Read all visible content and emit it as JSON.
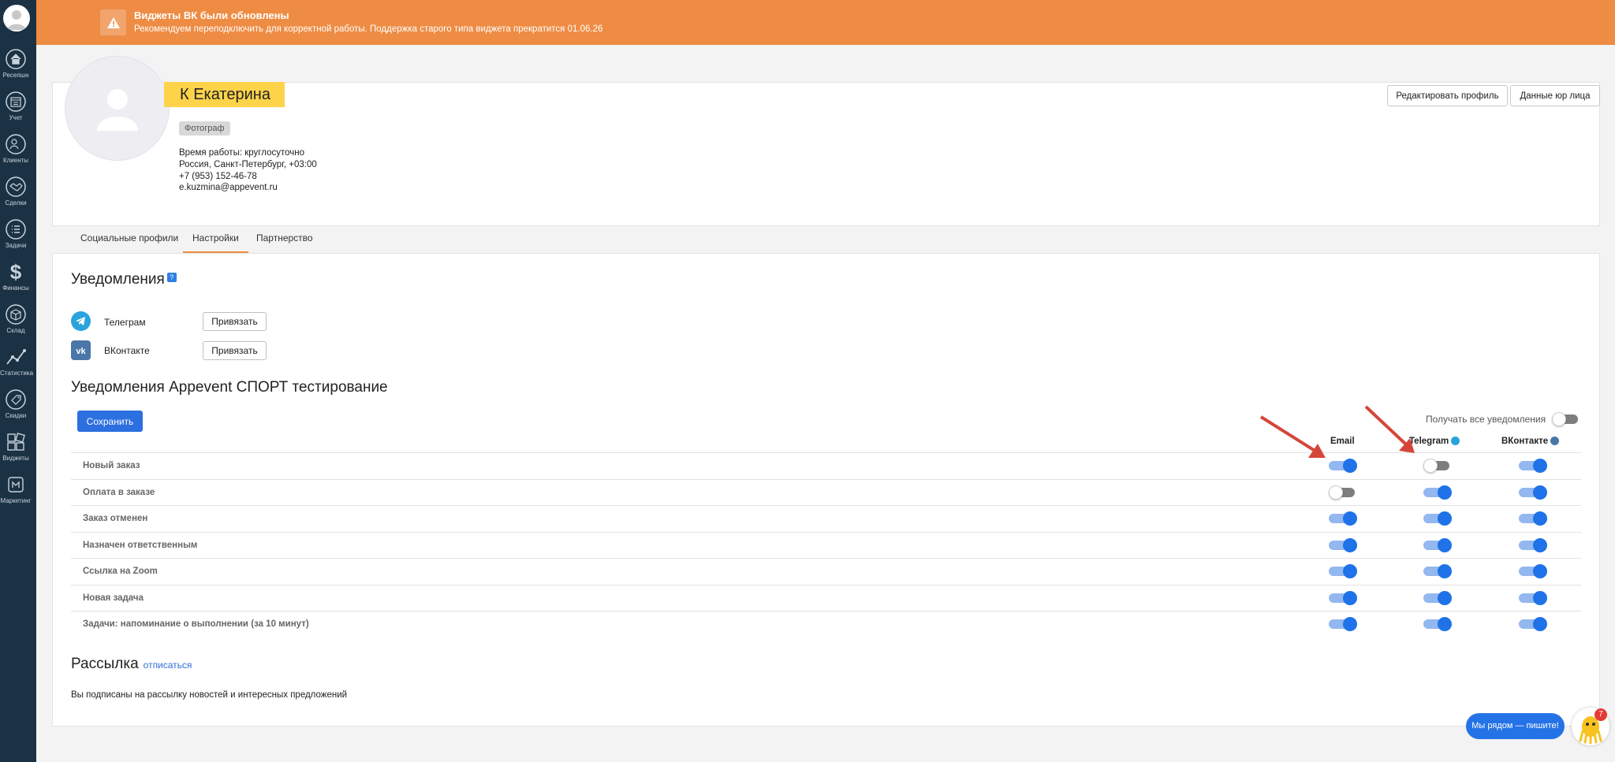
{
  "sidebar": {
    "items": [
      {
        "label": "Ресепшн",
        "icon": "home-icon"
      },
      {
        "label": "Учет",
        "icon": "calendar-icon"
      },
      {
        "label": "Клиенты",
        "icon": "users-icon"
      },
      {
        "label": "Сделки",
        "icon": "handshake-icon"
      },
      {
        "label": "Задачи",
        "icon": "tasks-icon"
      },
      {
        "label": "Финансы",
        "icon": "dollar-icon"
      },
      {
        "label": "Склад",
        "icon": "box-icon"
      },
      {
        "label": "Статистика",
        "icon": "chart-icon"
      },
      {
        "label": "Скидки",
        "icon": "tag-icon"
      },
      {
        "label": "Виджеты",
        "icon": "widgets-icon"
      },
      {
        "label": "Маркетинг",
        "icon": "marketing-icon"
      }
    ]
  },
  "banner": {
    "title": "Виджеты ВК были обновлены",
    "text": "Рекомендуем переподключить для корректной работы. Поддержка старого типа виджета прекратится 01.06.26",
    "color": "#ee8c44"
  },
  "profile": {
    "name": "К Екатерина",
    "role": "Фотограф",
    "work_hours": "Время работы: круглосуточно",
    "location": "Россия, Санкт-Петербург, +03:00",
    "phone": "+7 (953) 152-46-78",
    "email": "e.kuzmina@appevent.ru",
    "edit_button": "Редактировать профиль",
    "legal_button": "Данные юр лица"
  },
  "tabs": [
    {
      "label": "Социальные профили",
      "active": false
    },
    {
      "label": "Настройки",
      "active": true
    },
    {
      "label": "Партнерство",
      "active": false
    }
  ],
  "notifications": {
    "title": "Уведомления",
    "help": "?",
    "telegram_label": "Телеграм",
    "vk_label": "ВКонтакте",
    "bind_button": "Привязать"
  },
  "sport": {
    "title": "Уведомления Appevent СПОРТ тестирование",
    "save_button": "Сохранить",
    "all_label": "Получать все уведомления",
    "all_enabled": false,
    "columns": [
      "Email",
      "Telegram",
      "ВКонтакте"
    ],
    "rows": [
      {
        "label": "Новый заказ",
        "values": [
          true,
          false,
          true
        ]
      },
      {
        "label": "Оплата в заказе",
        "values": [
          false,
          true,
          true
        ]
      },
      {
        "label": "Заказ отменен",
        "values": [
          true,
          true,
          true
        ]
      },
      {
        "label": "Назначен ответственным",
        "values": [
          true,
          true,
          true
        ]
      },
      {
        "label": "Ссылка на Zoom",
        "values": [
          true,
          true,
          true
        ]
      },
      {
        "label": "Новая задача",
        "values": [
          true,
          true,
          true
        ]
      },
      {
        "label": "Задачи: напоминание о выполнении (за 10 минут)",
        "values": [
          true,
          true,
          true
        ]
      }
    ]
  },
  "mailing": {
    "title": "Рассылка",
    "unsubscribe": "отписаться",
    "text": "Вы подписаны на рассылку новостей и интересных предложений"
  },
  "chat": {
    "button": "Мы рядом — пишите!",
    "badge": "7"
  },
  "colors": {
    "accent": "#2c6fe0",
    "toggle_on": "#1f72e8",
    "name_highlight": "#fdd34a",
    "sidebar": "#1b3244"
  }
}
